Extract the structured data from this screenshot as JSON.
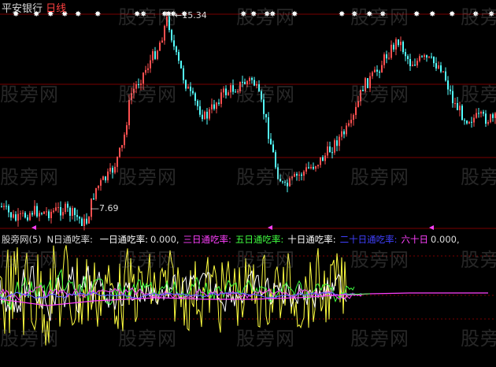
{
  "header": {
    "stock_name": "平安银行",
    "period": "日线",
    "high_marker": "←15.34",
    "low_marker": "—7.69"
  },
  "indicator": {
    "name": "股旁网(5)",
    "n_label": "N日通吃率:",
    "items": [
      {
        "label": "一日通吃率:",
        "value": "0.000,",
        "color": "#ffffff"
      },
      {
        "label": "三日通吃率:",
        "value": "",
        "color": "#ff40ff"
      },
      {
        "label": "五日通吃率:",
        "value": "",
        "color": "#40ff40"
      },
      {
        "label": "十日通吃率:",
        "value": "",
        "color": "#ffffff"
      },
      {
        "label": "二十日通吃率:",
        "value": "",
        "color": "#4040ff"
      },
      {
        "label": "六十日",
        "value": "0.000,",
        "color": "#ff40ff"
      }
    ]
  },
  "watermark": "股旁网",
  "colors": {
    "up": "#ff5050",
    "down": "#54ffff",
    "grid": "#7a0000",
    "line_white": "#ffffff",
    "line_yellow": "#ffff40",
    "line_magenta": "#ff40ff",
    "line_green": "#40ff40",
    "line_blue": "#6060ff"
  }
}
